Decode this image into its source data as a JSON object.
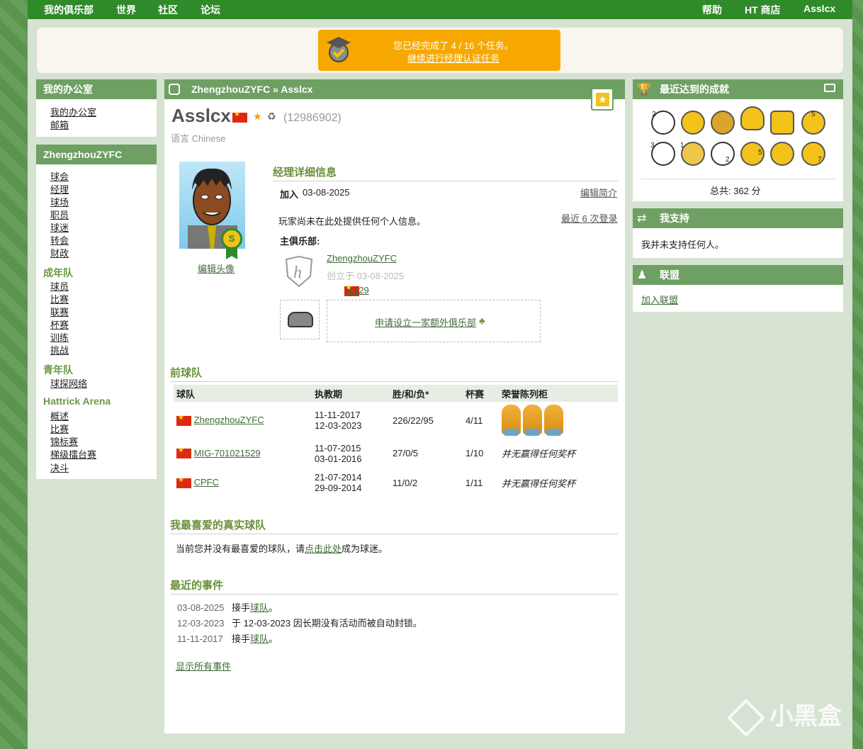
{
  "topnav": {
    "myclub": "我的俱乐部",
    "world": "世界",
    "community": "社区",
    "forum": "论坛",
    "help": "帮助",
    "shop": "HT 商店",
    "user": "Asslcx"
  },
  "promo": {
    "line1": "您已经完成了 4 / 16 个任务。",
    "line2": "继续进行经理认证任务"
  },
  "office": {
    "title": "我的办公室",
    "items": [
      "我的办公室",
      "邮箱"
    ]
  },
  "club": {
    "title": "ZhengzhouZYFC",
    "items": [
      "球会",
      "经理",
      "球场",
      "职员",
      "球迷",
      "转会",
      "财政"
    ],
    "senior_title": "成年队",
    "senior": [
      "球员",
      "比赛",
      "联赛",
      "杯赛",
      "训练",
      "挑战"
    ],
    "youth_title": "青年队",
    "youth": [
      "球探网络"
    ],
    "arena_title": "Hattrick Arena",
    "arena": [
      "概述",
      "比赛",
      "锦标赛",
      "梯级擂台赛",
      "决斗"
    ]
  },
  "breadcrumb": {
    "club": "ZhengzhouZYFC »",
    "user": "Asslcx"
  },
  "profile": {
    "name": "Asslcx",
    "id": "(12986902)",
    "language": "语言 Chinese",
    "edit_avatar": "编辑头像",
    "details_title": "经理详细信息",
    "join_label": "加入",
    "join_date": "03-08-2025",
    "edit_profile": "编辑简介",
    "no_info": "玩家尚未在此处提供任何个人信息。",
    "recent_logins": "最近 6 次登录",
    "main_club_label": "主俱乐部:",
    "club_name": "ZhengzhouZYFC",
    "club_founded": "创立于 03-08-2025",
    "league": "V.129",
    "extra_club": "申请设立一家额外俱乐部"
  },
  "prev": {
    "title": "前球队",
    "headers": [
      "球队",
      "执教期",
      "胜/和/负*",
      "杯赛",
      "荣誉陈列柜"
    ],
    "rows": [
      {
        "team": "ZhengzhouZYFC",
        "from": "11-11-2017",
        "to": "12-03-2023",
        "wdl": "226/22/95",
        "cups": "4/11",
        "honours": ""
      },
      {
        "team": "MIG-701021529",
        "from": "11-07-2015",
        "to": "03-01-2016",
        "wdl": "27/0/5",
        "cups": "1/10",
        "honours": "并无赢得任何奖杯"
      },
      {
        "team": "CPFC",
        "from": "21-07-2014",
        "to": "29-09-2014",
        "wdl": "11/0/2",
        "cups": "1/11",
        "honours": "并无赢得任何奖杯"
      }
    ]
  },
  "fav": {
    "title": "我最喜爱的真实球队",
    "text_a": "当前您并没有最喜爱的球队，请",
    "link": "点击此处",
    "text_b": "成为球迷。"
  },
  "events": {
    "title": "最近的事件",
    "items": [
      {
        "date": "03-08-2025",
        "pre": "接手",
        "link": "球队",
        "post": "。"
      },
      {
        "date": "12-03-2023",
        "pre": "于 12-03-2023 因长期没有活动而被自动封锁。",
        "link": "",
        "post": ""
      },
      {
        "date": "11-11-2017",
        "pre": "接手",
        "link": "球队",
        "post": "。"
      }
    ],
    "show_all": "显示所有事件"
  },
  "achievements": {
    "title": "最近达到的成就",
    "total": "总共:  362 分",
    "badges_top": [
      "2",
      "",
      "",
      "",
      "",
      "5"
    ],
    "badges_bottom": [
      "3",
      "1",
      "2",
      "5",
      "",
      "7"
    ]
  },
  "support": {
    "title": "我支持",
    "text": "我并未支持任何人。"
  },
  "alliance": {
    "title": "联盟",
    "link": "加入联盟"
  },
  "watermark": "小黑盒",
  "colors": {
    "nav": "#2f8a2a",
    "header": "#6e9f63",
    "promo": "#f7a800",
    "link": "#3f6b37"
  }
}
